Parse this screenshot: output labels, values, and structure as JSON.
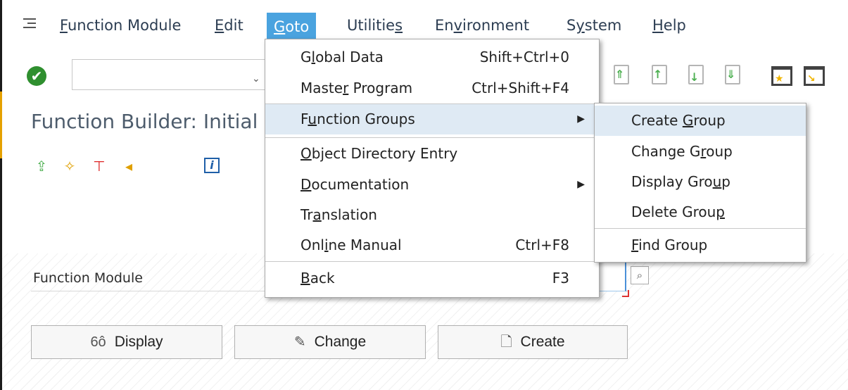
{
  "menubar": {
    "items": [
      {
        "pre": "",
        "mn": "F",
        "post": "unction Module"
      },
      {
        "pre": "",
        "mn": "E",
        "post": "dit"
      },
      {
        "pre": "",
        "mn": "G",
        "post": "oto"
      },
      {
        "pre": "Utilitie",
        "mn": "s",
        "post": ""
      },
      {
        "pre": "En",
        "mn": "v",
        "post": "ironment"
      },
      {
        "pre": "S",
        "mn": "y",
        "post": "stem"
      },
      {
        "pre": "",
        "mn": "H",
        "post": "elp"
      }
    ]
  },
  "toolbar": {
    "ok_glyph": "✔",
    "command_value": "",
    "chevron": "⌄"
  },
  "page": {
    "title": "Function Builder: Initial Screen"
  },
  "app_toolbar": {
    "info_glyph": "i"
  },
  "form": {
    "field_label": "Function Module",
    "field_value": "",
    "help_glyph": "⌕"
  },
  "buttons": {
    "display": {
      "icon": "6ô",
      "label": "Display"
    },
    "change": {
      "icon": "✎",
      "label": "Change"
    },
    "create": {
      "icon": "🗋",
      "label": "Create"
    }
  },
  "goto_menu": {
    "items": [
      {
        "pre": "G",
        "mn": "l",
        "post": "obal Data",
        "shortcut": "Shift+Ctrl+0"
      },
      {
        "pre": "Maste",
        "mn": "r",
        "post": " Program",
        "shortcut": "Ctrl+Shift+F4"
      },
      {
        "pre": "F",
        "mn": "u",
        "post": "nction Groups",
        "arrow": "▶"
      },
      {
        "pre": "",
        "mn": "O",
        "post": "bject Directory Entry"
      },
      {
        "pre": "",
        "mn": "D",
        "post": "ocumentation",
        "arrow": "▶"
      },
      {
        "pre": "Tr",
        "mn": "a",
        "post": "nslation"
      },
      {
        "pre": "Onl",
        "mn": "i",
        "post": "ne Manual",
        "shortcut": "Ctrl+F8"
      },
      {
        "pre": "",
        "mn": "B",
        "post": "ack",
        "shortcut": "F3"
      }
    ]
  },
  "function_groups_submenu": {
    "items": [
      {
        "pre": "Create ",
        "mn": "G",
        "post": "roup"
      },
      {
        "pre": "Change G",
        "mn": "r",
        "post": "oup"
      },
      {
        "pre": "Display Gro",
        "mn": "u",
        "post": "p"
      },
      {
        "pre": "Delete Grou",
        "mn": "p",
        "post": ""
      },
      {
        "pre": "",
        "mn": "F",
        "post": "ind Group"
      }
    ]
  },
  "colors": {
    "menu_active": "#4aa3df",
    "highlight": "#dfeaf4",
    "ok_green": "#2f8f2f",
    "title_text": "#4d5c6c"
  }
}
